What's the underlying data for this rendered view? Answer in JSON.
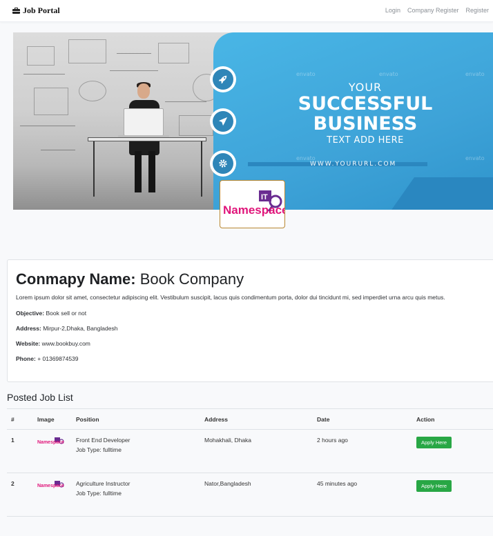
{
  "navbar": {
    "brand": "Job Portal",
    "brand_icon": "briefcase-icon",
    "links": [
      "Login",
      "Company Register",
      "Register"
    ]
  },
  "banner": {
    "headline_line1": "YOUR",
    "headline_line2": "SUCCESSFUL",
    "headline_line3": "BUSINESS",
    "headline_line4": "TEXT ADD HERE",
    "url": "WWW.YOURURL.COM",
    "watermark": "envato",
    "icons": [
      "rocket-icon",
      "paper-plane-icon",
      "gear-icon"
    ],
    "colors": {
      "blue": "#3fa9dc",
      "dark_blue": "#2f86b8"
    }
  },
  "logo": {
    "text": "Namespace",
    "badge": "IT",
    "colors": {
      "pink": "#e0157a",
      "purple": "#6a2c91"
    }
  },
  "company": {
    "name_label": "Conmapy Name:",
    "name": "Book Company",
    "description": "Lorem ipsum dolor sit amet, consectetur adipiscing elit. Vestibulum suscipit, lacus quis condimentum porta, dolor dui tincidunt mi, sed imperdiet urna arcu quis metus.",
    "objective_label": "Objective:",
    "objective": "Book sell or not",
    "address_label": "Address:",
    "address": "Mirpur-2,Dhaka, Bangladesh",
    "website_label": "Website:",
    "website": "www.bookbuy.com",
    "phone_label": "Phone:",
    "phone": "+ 01369874539"
  },
  "jobs": {
    "title": "Posted Job List",
    "columns": [
      "#",
      "Image",
      "Position",
      "Address",
      "Date",
      "Action"
    ],
    "rows": [
      {
        "num": "1",
        "position": "Front End Developer",
        "job_type": "Job Type: fulltime",
        "address": "Mohakhali, Dhaka",
        "date": "2 hours ago",
        "action": "Apply Here"
      },
      {
        "num": "2",
        "position": "Agriculture Instructor",
        "job_type": "Job Type: fulltime",
        "address": "Nator,Bangladesh",
        "date": "45 minutes ago",
        "action": "Apply Here"
      }
    ],
    "action_color": "#28a745"
  }
}
